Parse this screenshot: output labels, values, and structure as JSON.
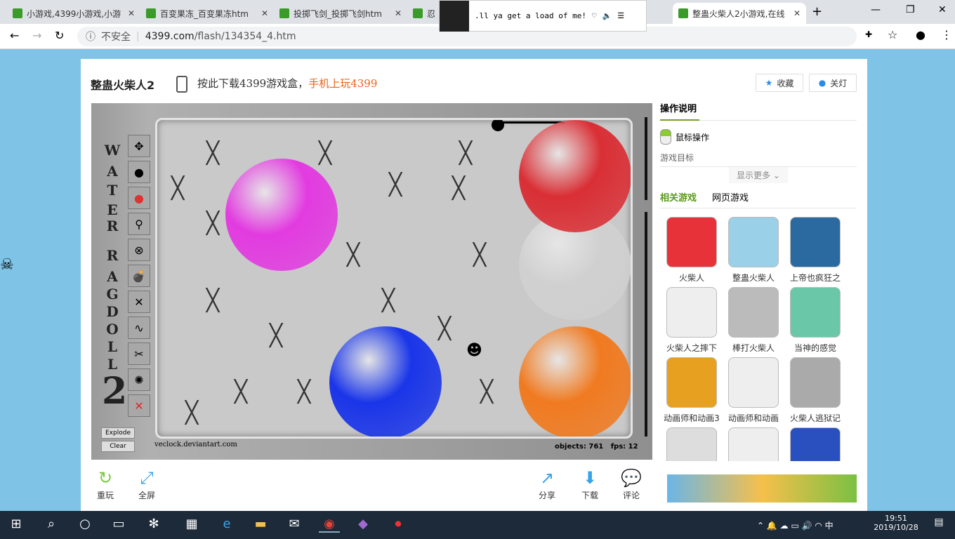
{
  "browser": {
    "tabs": [
      {
        "label": "小游戏,4399小游戏,小游"
      },
      {
        "label": "百变果冻_百变果冻htm"
      },
      {
        "label": "投掷飞剑_投掷飞剑htm"
      },
      {
        "label": "忍"
      },
      {
        "label": "整蛊火柴人2小游戏,在线"
      }
    ],
    "security": "不安全",
    "url_domain": "4399.com",
    "url_path": "/flash/134354_4.htm",
    "media_popup": {
      "text": ".ll ya get a load of me!"
    }
  },
  "page": {
    "game_title": "整蛊火柴人2",
    "promo": "按此下载4399游戏盒，",
    "promo_highlight": "手机上玩4399",
    "favorite": "收藏",
    "lights_off": "关灯",
    "game": {
      "title_letters": [
        "W",
        "A",
        "T",
        "E",
        "R",
        "R",
        "A",
        "G",
        "D",
        "O",
        "L",
        "L",
        "2"
      ],
      "explode": "Explode",
      "clear": "Clear",
      "credit": "veclock.deviantart.com",
      "stats": "objects: 761   fps: 12",
      "ball_colors": [
        "#e23be0",
        "#1a35e8",
        "#d92f35",
        "#d0d0d0",
        "#f07a20"
      ]
    },
    "actions": {
      "replay": "重玩",
      "fullscreen": "全屏",
      "share": "分享",
      "download": "下载",
      "comment": "评论"
    },
    "side": {
      "instructions_tab": "操作说明",
      "mouse_op": "鼠标操作",
      "goal": "游戏目标",
      "show_more": "显示更多",
      "related_tab": "相关游戏",
      "web_tab": "网页游戏",
      "games": [
        "火柴人",
        "整蛊火柴人",
        "上帝也疯狂之",
        "火柴人之摔下",
        "棒打火柴人",
        "当神的感觉",
        "动画师和动画3",
        "动画师和动画",
        "火柴人逃狱记",
        "",
        "",
        ""
      ],
      "accent": "#5b9a1e"
    }
  },
  "taskbar": {
    "time": "19:51",
    "date": "2019/10/28",
    "ime": "中"
  }
}
